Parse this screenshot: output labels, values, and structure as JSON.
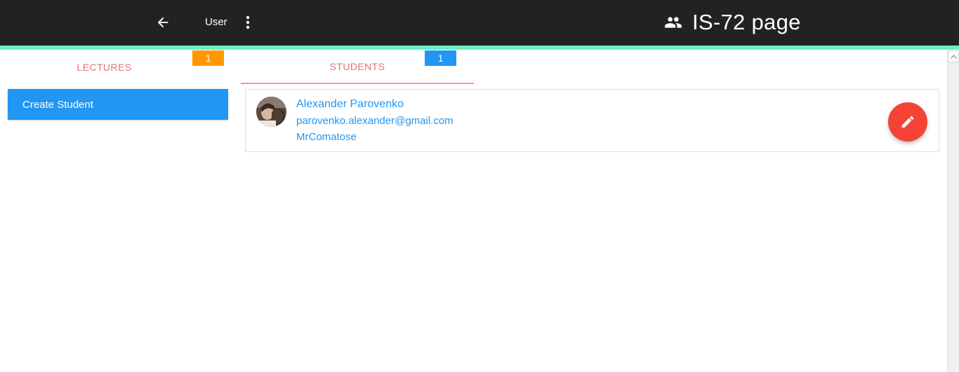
{
  "header": {
    "user_label": "User",
    "page_title": "IS-72 page",
    "background_color": "#222222",
    "accent_color": "#64f0c8"
  },
  "tabs": [
    {
      "label": "LECTURES",
      "badge": "1",
      "badge_color": "#ff9800",
      "active": false
    },
    {
      "label": "STUDENTS",
      "badge": "1",
      "badge_color": "#2196f3",
      "active": true
    }
  ],
  "sidebar": {
    "create_button_label": "Create Student",
    "button_color": "#2196f3"
  },
  "students": [
    {
      "name": "Alexander Parovenko",
      "email": "parovenko.alexander@gmail.com",
      "username": "MrComatose"
    }
  ],
  "icons": {
    "back": "arrow-back-icon",
    "more": "more-vert-icon",
    "group": "people-icon",
    "edit": "pencil-icon",
    "scroll_up": "chevron-up-icon"
  },
  "colors": {
    "link": "#2196f3",
    "fab": "#f44336",
    "tab_text": "#e57373"
  }
}
